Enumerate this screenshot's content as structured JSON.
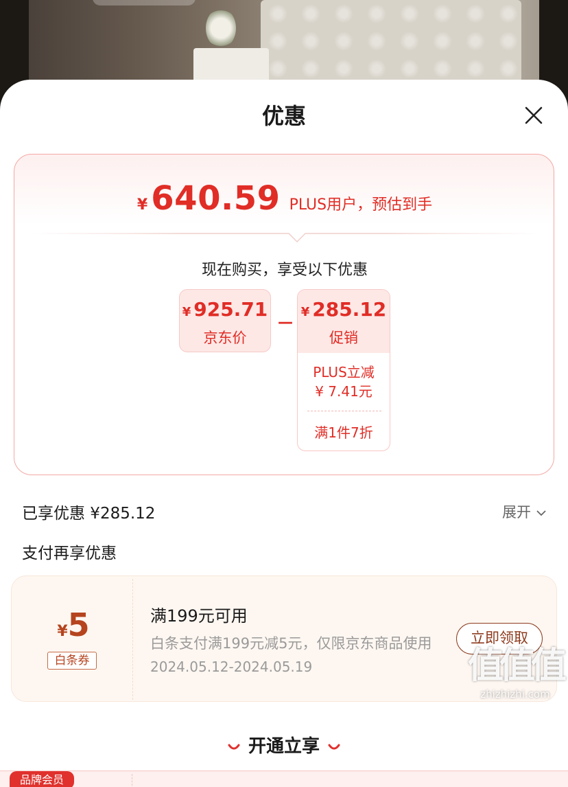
{
  "sheet": {
    "title": "优惠"
  },
  "estimate": {
    "currency": "¥",
    "price": "640.59",
    "note": "PLUS用户，预估到手"
  },
  "breakdown": {
    "intro": "现在购买，享受以下优惠",
    "jd_price": {
      "currency": "¥",
      "amount": "925.71",
      "label": "京东价"
    },
    "operator": "－",
    "promotion": {
      "currency": "¥",
      "amount": "285.12",
      "label": "促销",
      "items": [
        {
          "line1": "PLUS立减",
          "line2": "¥ 7.41元"
        },
        {
          "line1": "满1件7折"
        }
      ]
    }
  },
  "enjoyed": {
    "label": "已享优惠 ¥285.12",
    "expand": "展开"
  },
  "pay_section": {
    "title": "支付再享优惠"
  },
  "coupon": {
    "currency": "¥",
    "value": "5",
    "tag": "白条券",
    "title": "满199元可用",
    "description": "白条支付满199元减5元，仅限京东商品使用",
    "validity": "2024.05.12-2024.05.19",
    "action": "立即领取",
    "accent_color": "#b5441f"
  },
  "membership": {
    "title": "开通立享",
    "badge": "品牌会员"
  },
  "watermark": {
    "logo": "值值值",
    "domain": "zhizhizhi.com"
  },
  "colors": {
    "price_red": "#e02d26",
    "coupon_brown": "#8d3b1e"
  },
  "icons": {
    "close": "close-icon",
    "expand": "chevron-down-icon"
  }
}
